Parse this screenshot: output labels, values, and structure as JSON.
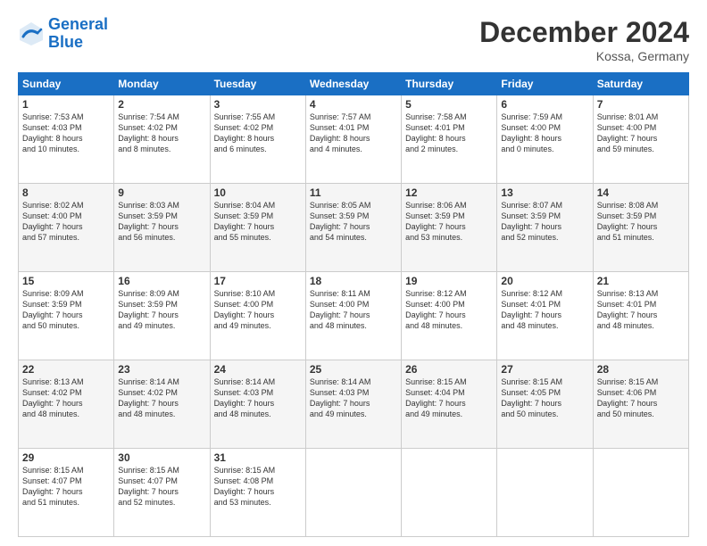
{
  "header": {
    "logo_line1": "General",
    "logo_line2": "Blue",
    "month_title": "December 2024",
    "location": "Kossa, Germany"
  },
  "weekdays": [
    "Sunday",
    "Monday",
    "Tuesday",
    "Wednesday",
    "Thursday",
    "Friday",
    "Saturday"
  ],
  "weeks": [
    [
      {
        "day": "1",
        "info": "Sunrise: 7:53 AM\nSunset: 4:03 PM\nDaylight: 8 hours\nand 10 minutes."
      },
      {
        "day": "2",
        "info": "Sunrise: 7:54 AM\nSunset: 4:02 PM\nDaylight: 8 hours\nand 8 minutes."
      },
      {
        "day": "3",
        "info": "Sunrise: 7:55 AM\nSunset: 4:02 PM\nDaylight: 8 hours\nand 6 minutes."
      },
      {
        "day": "4",
        "info": "Sunrise: 7:57 AM\nSunset: 4:01 PM\nDaylight: 8 hours\nand 4 minutes."
      },
      {
        "day": "5",
        "info": "Sunrise: 7:58 AM\nSunset: 4:01 PM\nDaylight: 8 hours\nand 2 minutes."
      },
      {
        "day": "6",
        "info": "Sunrise: 7:59 AM\nSunset: 4:00 PM\nDaylight: 8 hours\nand 0 minutes."
      },
      {
        "day": "7",
        "info": "Sunrise: 8:01 AM\nSunset: 4:00 PM\nDaylight: 7 hours\nand 59 minutes."
      }
    ],
    [
      {
        "day": "8",
        "info": "Sunrise: 8:02 AM\nSunset: 4:00 PM\nDaylight: 7 hours\nand 57 minutes."
      },
      {
        "day": "9",
        "info": "Sunrise: 8:03 AM\nSunset: 3:59 PM\nDaylight: 7 hours\nand 56 minutes."
      },
      {
        "day": "10",
        "info": "Sunrise: 8:04 AM\nSunset: 3:59 PM\nDaylight: 7 hours\nand 55 minutes."
      },
      {
        "day": "11",
        "info": "Sunrise: 8:05 AM\nSunset: 3:59 PM\nDaylight: 7 hours\nand 54 minutes."
      },
      {
        "day": "12",
        "info": "Sunrise: 8:06 AM\nSunset: 3:59 PM\nDaylight: 7 hours\nand 53 minutes."
      },
      {
        "day": "13",
        "info": "Sunrise: 8:07 AM\nSunset: 3:59 PM\nDaylight: 7 hours\nand 52 minutes."
      },
      {
        "day": "14",
        "info": "Sunrise: 8:08 AM\nSunset: 3:59 PM\nDaylight: 7 hours\nand 51 minutes."
      }
    ],
    [
      {
        "day": "15",
        "info": "Sunrise: 8:09 AM\nSunset: 3:59 PM\nDaylight: 7 hours\nand 50 minutes."
      },
      {
        "day": "16",
        "info": "Sunrise: 8:09 AM\nSunset: 3:59 PM\nDaylight: 7 hours\nand 49 minutes."
      },
      {
        "day": "17",
        "info": "Sunrise: 8:10 AM\nSunset: 4:00 PM\nDaylight: 7 hours\nand 49 minutes."
      },
      {
        "day": "18",
        "info": "Sunrise: 8:11 AM\nSunset: 4:00 PM\nDaylight: 7 hours\nand 48 minutes."
      },
      {
        "day": "19",
        "info": "Sunrise: 8:12 AM\nSunset: 4:00 PM\nDaylight: 7 hours\nand 48 minutes."
      },
      {
        "day": "20",
        "info": "Sunrise: 8:12 AM\nSunset: 4:01 PM\nDaylight: 7 hours\nand 48 minutes."
      },
      {
        "day": "21",
        "info": "Sunrise: 8:13 AM\nSunset: 4:01 PM\nDaylight: 7 hours\nand 48 minutes."
      }
    ],
    [
      {
        "day": "22",
        "info": "Sunrise: 8:13 AM\nSunset: 4:02 PM\nDaylight: 7 hours\nand 48 minutes."
      },
      {
        "day": "23",
        "info": "Sunrise: 8:14 AM\nSunset: 4:02 PM\nDaylight: 7 hours\nand 48 minutes."
      },
      {
        "day": "24",
        "info": "Sunrise: 8:14 AM\nSunset: 4:03 PM\nDaylight: 7 hours\nand 48 minutes."
      },
      {
        "day": "25",
        "info": "Sunrise: 8:14 AM\nSunset: 4:03 PM\nDaylight: 7 hours\nand 49 minutes."
      },
      {
        "day": "26",
        "info": "Sunrise: 8:15 AM\nSunset: 4:04 PM\nDaylight: 7 hours\nand 49 minutes."
      },
      {
        "day": "27",
        "info": "Sunrise: 8:15 AM\nSunset: 4:05 PM\nDaylight: 7 hours\nand 50 minutes."
      },
      {
        "day": "28",
        "info": "Sunrise: 8:15 AM\nSunset: 4:06 PM\nDaylight: 7 hours\nand 50 minutes."
      }
    ],
    [
      {
        "day": "29",
        "info": "Sunrise: 8:15 AM\nSunset: 4:07 PM\nDaylight: 7 hours\nand 51 minutes."
      },
      {
        "day": "30",
        "info": "Sunrise: 8:15 AM\nSunset: 4:07 PM\nDaylight: 7 hours\nand 52 minutes."
      },
      {
        "day": "31",
        "info": "Sunrise: 8:15 AM\nSunset: 4:08 PM\nDaylight: 7 hours\nand 53 minutes."
      },
      null,
      null,
      null,
      null
    ]
  ]
}
